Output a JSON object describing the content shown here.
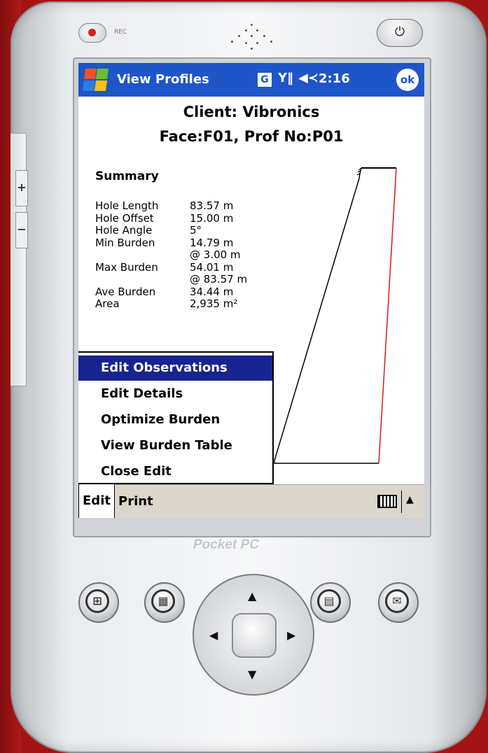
{
  "device": {
    "rec_label": "REC",
    "power_icon": "power-icon",
    "brand": "Pocket PC",
    "side_plus": "+",
    "side_minus": "−"
  },
  "titlebar": {
    "title": "View Profiles",
    "g_label": "G",
    "signal_icon": "signal-icon",
    "volume_icon": "volume-icon",
    "time": "2:16",
    "ok_label": "ok"
  },
  "header": {
    "client": "Client: Vibronics",
    "face": "Face:F01, Prof No:P01"
  },
  "summary": {
    "title": "Summary",
    "rows": [
      {
        "k": "Hole Length",
        "v": "83.57 m"
      },
      {
        "k": "Hole Offset",
        "v": "15.00 m"
      },
      {
        "k": "Hole Angle",
        "v": "5°"
      },
      {
        "k": "Min Burden",
        "v": "14.79 m"
      },
      {
        "k": "",
        "v": " @ 3.00 m"
      },
      {
        "k": "Max Burden",
        "v": "54.01 m"
      },
      {
        "k": "",
        "v": " @ 83.57 m"
      },
      {
        "k": "Ave Burden",
        "v": "34.44 m"
      },
      {
        "k": "Area",
        "v": "2,935 m²"
      }
    ]
  },
  "menu": {
    "items": [
      {
        "label": "Edit Observations",
        "selected": true
      },
      {
        "label": "Edit Details",
        "selected": false
      },
      {
        "label": "Optimize Burden",
        "selected": false
      },
      {
        "label": "View Burden Table",
        "selected": false
      },
      {
        "label": "Close Edit",
        "selected": false
      }
    ]
  },
  "menubar": {
    "edit": "Edit",
    "print": "Print",
    "keyboard_icon": "keyboard-icon",
    "arrow": "▲"
  },
  "colors": {
    "titlebar": "#1e55c8",
    "menu_selected": "#17238f",
    "profile_face": "#000000",
    "profile_hole": "#e01818",
    "background": "#a51414"
  }
}
